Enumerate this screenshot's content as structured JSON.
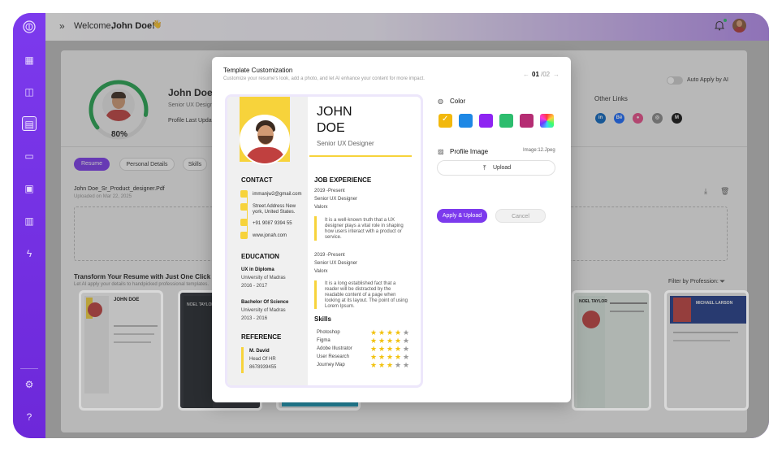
{
  "topbar": {
    "welcome": "Welcome,",
    "user": "John Doe!",
    "wave": "👋"
  },
  "profile": {
    "percent": "80%",
    "percent_value": 0.8,
    "name": "John Doe",
    "role": "Senior UX Designer",
    "last_updated": "Profile Last Updated"
  },
  "auto_apply": {
    "label": "Auto Apply by AI"
  },
  "other_links": {
    "title": "Other Links",
    "items": [
      "in",
      "Be",
      "dribbble",
      "github",
      "medium"
    ]
  },
  "tabs": [
    "Resume",
    "Personal Details",
    "Skills"
  ],
  "file": {
    "name": "John Doe_Sr_Product_designer.Pdf",
    "uploaded": "Uploaded on Mar 22, 2025"
  },
  "transform": {
    "title": "Transform Your Resume with Just One Click",
    "subtitle": "Let AI apply your details to handpicked professional templates.",
    "filter": "Filter by Profession:"
  },
  "modal": {
    "title": "Template Customization",
    "subtitle": "Customize your resume's look, add a photo, and let AI enhance your content for more impact.",
    "page_current": "01",
    "page_total": "/02",
    "color_label": "Color",
    "colors": [
      "#f2b80c",
      "#1e88e5",
      "#8e24f2",
      "#2dbd6e",
      "#b52d73"
    ],
    "profile_image_label": "Profile Image",
    "image_name": "Image:12.Jpeg",
    "upload_label": "Upload",
    "apply_label": "Apply & Upload",
    "cancel_label": "Cancel"
  },
  "resume": {
    "first": "JOHN",
    "last": "DOE",
    "title": "Senior UX Designer",
    "contact_h": "CONTACT",
    "email": "immanjw2@gmail.com",
    "address1": "Street Address New",
    "address2": "york, United States.",
    "phone": "+91 9087 9394 55",
    "web": "www.jonah.com",
    "education_h": "EDUCATION",
    "edu1": [
      "UX in  Diploma",
      "University of Madras",
      "2016 - 2017"
    ],
    "edu2": [
      "Bachelor Of Science",
      "University of Madras",
      "2013 - 2016"
    ],
    "reference_h": "REFERENCE",
    "ref": [
      "M. David",
      "Head Of HR",
      "8678939455"
    ],
    "job_h": "JOB EXPERIENCE",
    "job1": [
      "2019 -Present",
      "Senior UX Designer",
      "Valorx"
    ],
    "job1_text": [
      "It is a well-known truth that a UX",
      "designer plays a vital role in shaping",
      "how users interact with a product or",
      "service."
    ],
    "job2": [
      "2019 -Present",
      "Senior UX Designer",
      "Valorx"
    ],
    "job2_text": [
      "It is a long established fact that a",
      "reader will be distracted by the",
      "readable content of a page when",
      "looking at its layout. The point of using",
      "Lorem Ipsum."
    ],
    "skills_h": "Skills",
    "skills": [
      {
        "name": "Photoshop",
        "stars": 4
      },
      {
        "name": "Figma",
        "stars": 4
      },
      {
        "name": "Adobe Illustrator",
        "stars": 4
      },
      {
        "name": "User Research",
        "stars": 4
      },
      {
        "name": "Journey Map",
        "stars": 3
      }
    ]
  },
  "thumbs": {
    "t1_name": "JOHN DOE",
    "t2_name": "NOEL TAYLOR",
    "t4_name": "NOEL TAYLOR",
    "t5_name": "MICHAEL LARSON"
  },
  "colors_theme": {
    "accent": "#7c3aed",
    "yellow": "#f7d33b",
    "star": "#f2c20f"
  }
}
